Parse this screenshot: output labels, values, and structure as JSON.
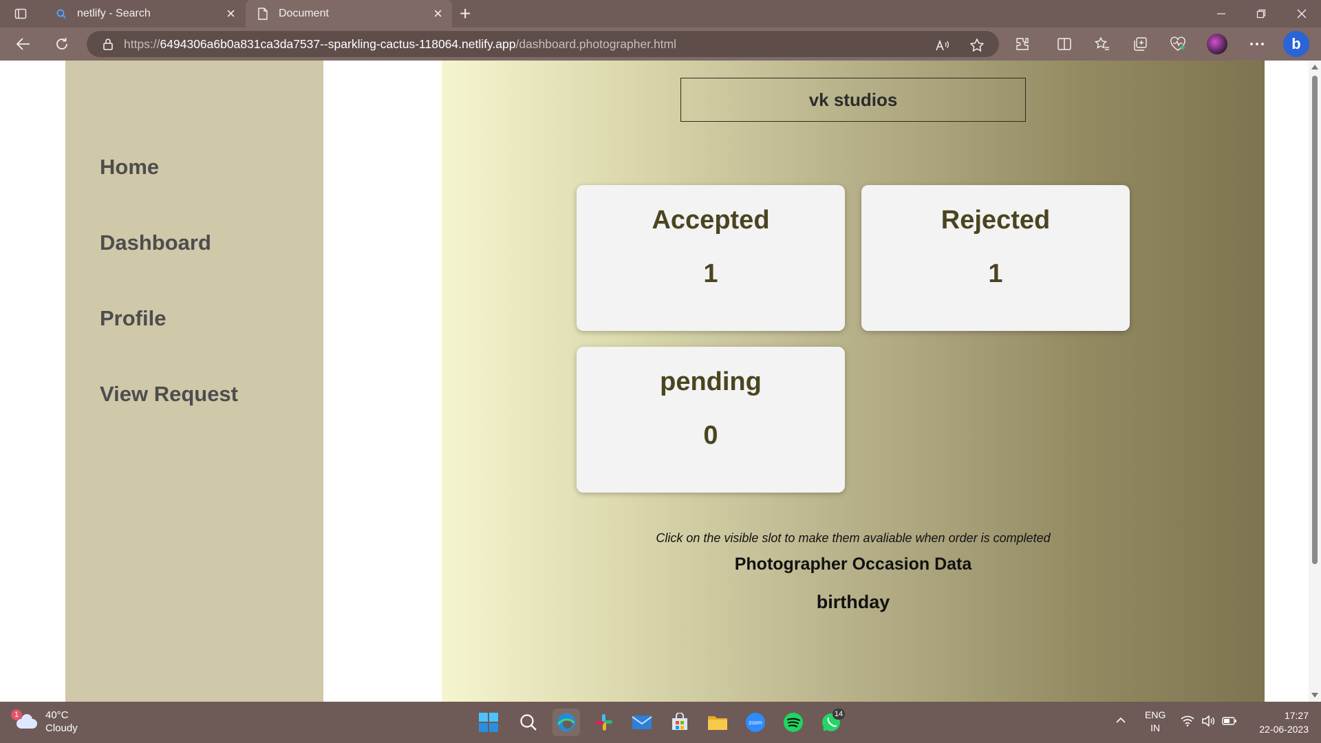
{
  "browser": {
    "tabs": [
      {
        "title": "netlify - Search",
        "active": false
      },
      {
        "title": "Document",
        "active": true
      }
    ],
    "url_prefix": "https://",
    "url_host": "6494306a6b0a831ca3da7537--sparkling-cactus-118064.netlify.app",
    "url_path": "/dashboard.photographer.html"
  },
  "sidebar": {
    "items": [
      {
        "label": "Home"
      },
      {
        "label": "Dashboard"
      },
      {
        "label": "Profile"
      },
      {
        "label": "View Request"
      }
    ]
  },
  "main": {
    "studio_name": "vk studios",
    "cards": [
      {
        "title": "Accepted",
        "count": "1"
      },
      {
        "title": "Rejected",
        "count": "1"
      },
      {
        "title": "pending",
        "count": "0"
      }
    ],
    "hint": "Click on the visible slot to make them avaliable when order is completed",
    "occasion_title": "Photographer Occasion Data",
    "occasions": [
      "birthday"
    ]
  },
  "taskbar": {
    "weather_temp": "40°C",
    "weather_desc": "Cloudy",
    "weather_badge": "1",
    "whatsapp_badge": "14",
    "lang_line1": "ENG",
    "lang_line2": "IN",
    "time": "17:27",
    "date": "22-06-2023"
  },
  "colors": {
    "sidebar_bg": "#cfc8a9",
    "card_text": "#4a4520",
    "chrome_bg": "#7f6a66"
  }
}
